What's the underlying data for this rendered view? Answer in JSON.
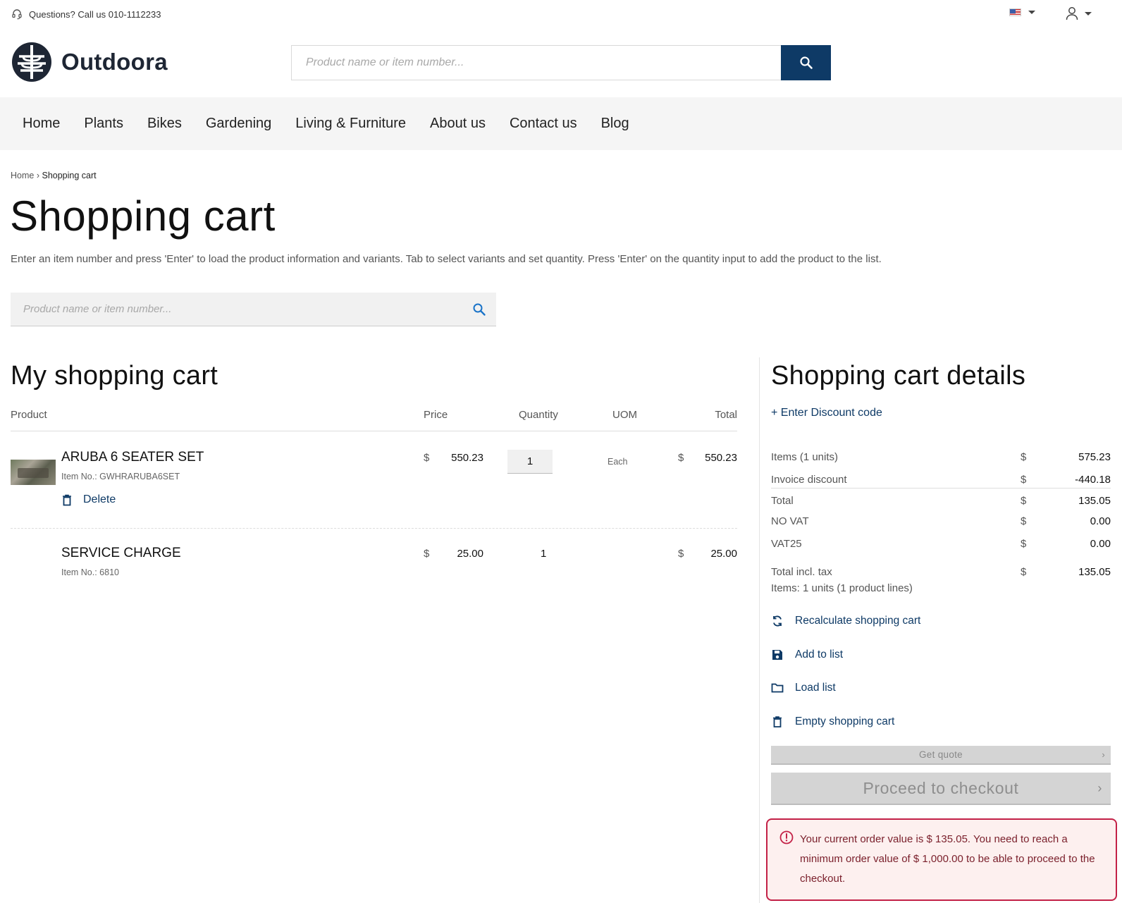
{
  "topbar": {
    "help_text": "Questions? Call us 010-1112233",
    "help_icon": "headset-icon",
    "language_icon": "us-flag-icon",
    "user_icon": "user-icon"
  },
  "header": {
    "brand_name": "Outdoora",
    "search_placeholder": "Product name or item number...",
    "search_icon": "search-icon"
  },
  "nav": {
    "items": [
      "Home",
      "Plants",
      "Bikes",
      "Gardening",
      "Living & Furniture",
      "About us",
      "Contact us",
      "Blog"
    ]
  },
  "breadcrumb": {
    "home": "Home",
    "separator": "›",
    "current": "Shopping cart"
  },
  "page": {
    "title": "Shopping cart",
    "intro": "Enter an item number and press 'Enter' to load the product information and variants. Tab to select variants and set quantity. Press 'Enter' on the quantity input to add the product to the list.",
    "quick_search_placeholder": "Product name or item number..."
  },
  "cart": {
    "heading": "My shopping cart",
    "columns": {
      "product": "Product",
      "price": "Price",
      "quantity": "Quantity",
      "uom": "UOM",
      "total": "Total"
    },
    "currency": "$",
    "items": [
      {
        "name": "ARUBA 6 SEATER SET",
        "item_no": "Item No.: GWHRARUBA6SET",
        "price": "550.23",
        "quantity": "1",
        "uom": "Each",
        "total": "550.23",
        "delete_label": "Delete"
      },
      {
        "name": "SERVICE CHARGE",
        "item_no": "Item No.: 6810",
        "price": "25.00",
        "quantity": "1",
        "total": "25.00"
      }
    ]
  },
  "details": {
    "heading": "Shopping cart details",
    "discount_link": "+ Enter Discount code",
    "currency": "$",
    "rows": [
      {
        "label": "Items (1 units)",
        "value": "575.23"
      },
      {
        "label": "Invoice discount",
        "value": "-440.18"
      },
      {
        "label": "Total",
        "value": "135.05"
      },
      {
        "label": "NO VAT",
        "value": "0.00"
      },
      {
        "label": "VAT25",
        "value": "0.00"
      },
      {
        "label": "Total incl. tax",
        "value": "135.05"
      }
    ],
    "items_note": "Items: 1 units (1 product lines)",
    "actions": {
      "recalculate": "Recalculate shopping cart",
      "add_to_list": "Add to list",
      "load_list": "Load list",
      "empty_cart": "Empty shopping cart"
    },
    "get_quote": "Get quote",
    "checkout": "Proceed to checkout",
    "chevron": "›",
    "alert": "Your current order value is $ 135.05. You need to reach a minimum order value of $ 1,000.00 to be able to proceed to the checkout.",
    "colors": {
      "brand_navy": "#0e3a66",
      "alert_border": "#c32147",
      "alert_bg": "#fdf0ef",
      "disabled_button": "#d4d4d4"
    }
  }
}
